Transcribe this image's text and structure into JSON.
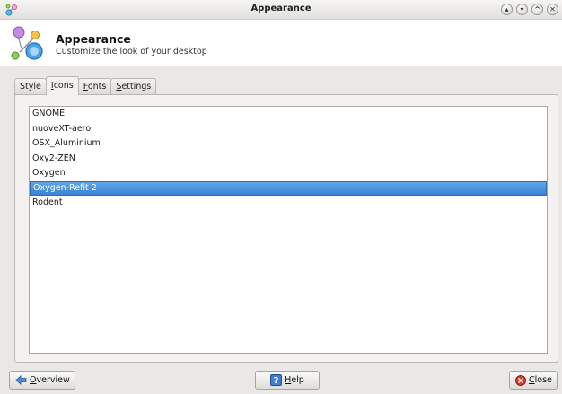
{
  "window": {
    "title": "Appearance",
    "buttons": [
      "minimize",
      "maximize-down",
      "maximize-up",
      "close"
    ]
  },
  "header": {
    "title": "Appearance",
    "subtitle": "Customize the look of your desktop"
  },
  "tabs": [
    {
      "label_first": "",
      "label_ul": "",
      "label_rest": "Style",
      "active": false
    },
    {
      "label_first": "",
      "label_ul": "I",
      "label_rest": "cons",
      "active": true
    },
    {
      "label_first": "",
      "label_ul": "F",
      "label_rest": "onts",
      "active": false
    },
    {
      "label_first": "",
      "label_ul": "S",
      "label_rest": "ettings",
      "active": false
    }
  ],
  "icon_themes": {
    "items": [
      "GNOME",
      "nuoveXT-aero",
      "OSX_Aluminium",
      "Oxy2-ZEN",
      "Oxygen",
      "Oxygen-Refit 2",
      "Rodent"
    ],
    "selected_index": 5
  },
  "buttons": {
    "overview": {
      "ul": "O",
      "rest": "verview"
    },
    "help": {
      "ul": "H",
      "rest": "elp"
    },
    "close": {
      "ul": "C",
      "rest": "lose"
    }
  },
  "colors": {
    "selection": "#3a84d4",
    "window_bg": "#e9e8e6"
  },
  "icons": {
    "app": "appearance-icon",
    "overview": "back-arrow-icon",
    "help": "help-icon",
    "close": "close-icon"
  }
}
